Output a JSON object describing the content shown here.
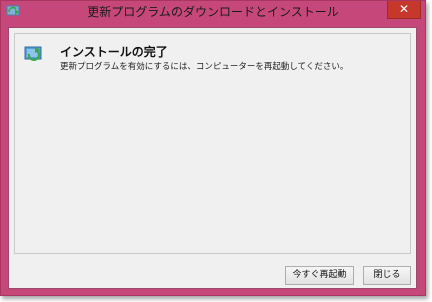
{
  "window": {
    "title": "更新プログラムのダウンロードとインストール",
    "close_glyph": "✕",
    "frame_color": "#c6487a"
  },
  "status": {
    "icon": "windows-update-icon",
    "heading": "インストールの完了",
    "message": "更新プログラムを有効にするには、コンピューターを再起動してください。"
  },
  "buttons": {
    "restart_now": "今すぐ再起動",
    "close": "閉じる"
  }
}
